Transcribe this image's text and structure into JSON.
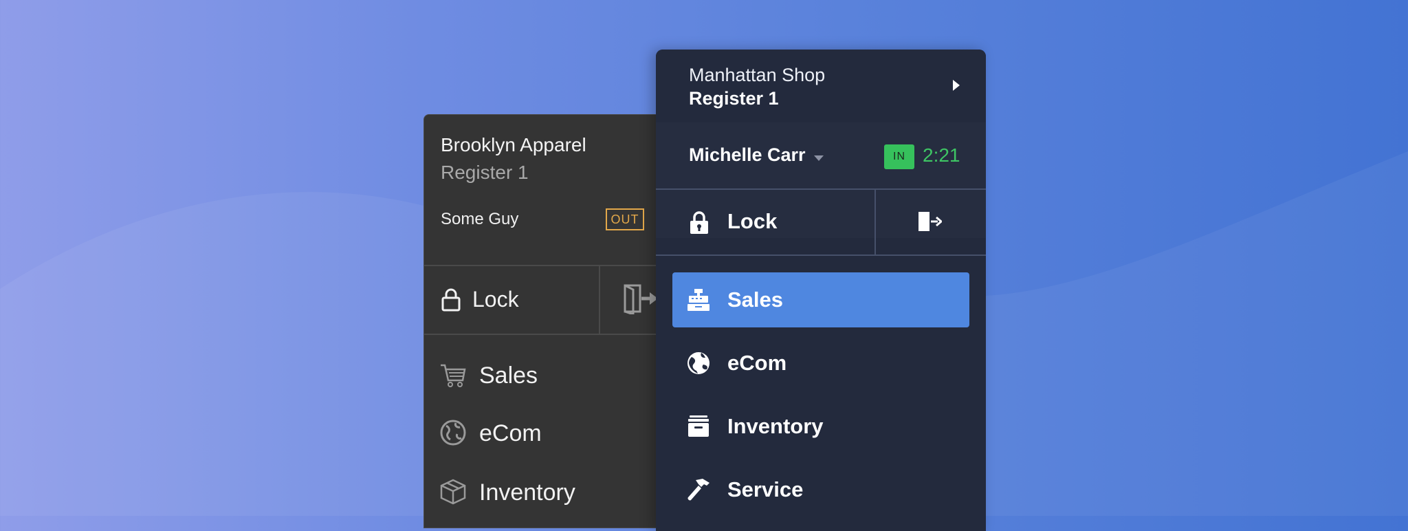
{
  "back_panel": {
    "store_name": "Brooklyn Apparel",
    "register": "Register 1",
    "user": "Some Guy",
    "status_badge": "OUT",
    "lock_label": "Lock",
    "nav": [
      {
        "label": "Sales",
        "icon": "cart-icon"
      },
      {
        "label": "eCom",
        "icon": "globe-icon"
      },
      {
        "label": "Inventory",
        "icon": "box-icon"
      }
    ]
  },
  "front_panel": {
    "store_name": "Manhattan Shop",
    "register": "Register 1",
    "user": "Michelle Carr",
    "status_badge": "IN",
    "clock_time": "2:21",
    "lock_label": "Lock",
    "nav": [
      {
        "label": "Sales",
        "icon": "cash-register-icon",
        "active": true
      },
      {
        "label": "eCom",
        "icon": "globe-icon"
      },
      {
        "label": "Inventory",
        "icon": "archive-icon"
      },
      {
        "label": "Service",
        "icon": "hammer-icon"
      }
    ]
  },
  "colors": {
    "accent": "#4f87e0",
    "status_in": "#36c15c",
    "status_out": "#e3a84a",
    "front_panel_bg": "#232a3d",
    "back_panel_bg": "#343434"
  }
}
